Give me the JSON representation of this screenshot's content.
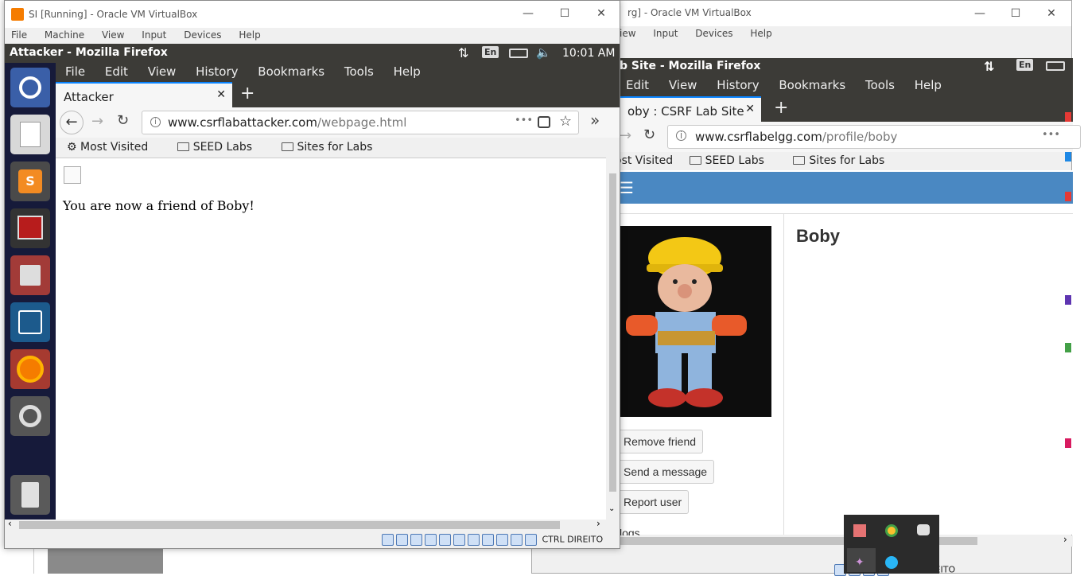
{
  "back_window": {
    "title": "rg] - Oracle VM VirtualBox",
    "menu": [
      "iew",
      "Input",
      "Devices",
      "Help"
    ],
    "vm_title": "b Site - Mozilla Firefox",
    "vm_lang": "En",
    "ff_menu": [
      "Edit",
      "View",
      "History",
      "Bookmarks",
      "Tools",
      "Help"
    ],
    "tab_label": "oby : CSRF Lab Site",
    "url_host": "www.csrflabelgg.com",
    "url_path": "/profile/boby",
    "url_more": "•••",
    "bookmarks": [
      "ost Visited",
      "SEED Labs",
      "Sites for Labs"
    ],
    "profile_name": "Boby",
    "buttons": [
      "Remove friend",
      "Send a message",
      "Report user"
    ],
    "blogs_label": "logs",
    "ctrl_label": "CTRL DIREITO",
    "hamburger": "☰"
  },
  "front_window": {
    "title": "SI [Running] - Oracle VM VirtualBox",
    "menu": [
      "File",
      "Machine",
      "View",
      "Input",
      "Devices",
      "Help"
    ],
    "vm_title": "Attacker - Mozilla Firefox",
    "vm_lang": "En",
    "vm_clock": "10:01 AM",
    "ff_menu": [
      "File",
      "Edit",
      "View",
      "History",
      "Bookmarks",
      "Tools",
      "Help"
    ],
    "tab_label": "Attacker",
    "url_host": "www.csrflabattacker.com",
    "url_path": "/webpage.html",
    "url_more": "•••",
    "bookmarks": [
      "Most Visited",
      "SEED Labs",
      "Sites for Labs"
    ],
    "page_text": "You are now a friend of Boby!",
    "ctrl_label": "CTRL DIREITO"
  },
  "colors": {
    "ubuntu_dark": "#3c3b37",
    "launcher": "#161a3a",
    "elgg_blue": "#4a88c2",
    "firefox_accent": "#0a84ff"
  }
}
